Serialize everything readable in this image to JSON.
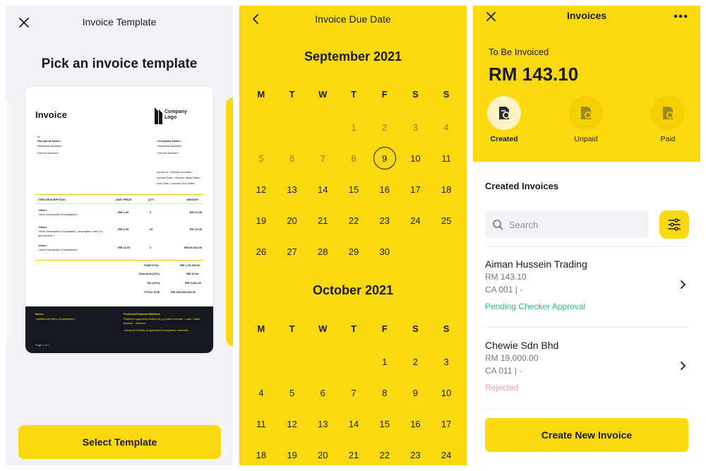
{
  "screen1": {
    "title": "Invoice Template",
    "heading": "Pick an invoice template",
    "template": {
      "invoice_title": "Invoice",
      "logo_text_1": "Company",
      "logo_text_2": "Logo",
      "to": "To :",
      "recipient_name": "<Recipient Name>",
      "business_address": "<Business Address>",
      "phone_number": "<Phone Number>",
      "company_name": "<Company Name>",
      "company_address": "<Business Address>",
      "company_phone": "<Phone Number>",
      "invoice_no": "Invoice #: <Invoice Number>",
      "invoice_date": "Invoice Date: <Invoice Issue Date>",
      "due_date": "Due Date: <Invoice Due Date>",
      "columns": [
        "ITEM DESCRIPTION",
        "UNIT PRICE",
        "QTY",
        "AMOUNT"
      ],
      "items": [
        {
          "name": "<Item>",
          "desc": "<Item Description (if available)>",
          "price": "RM 6.00",
          "qty": "2",
          "amount": "RM 24.00"
        },
        {
          "name": "<Item>",
          "desc": "<Item Description (if available), description until x to second line.>",
          "price": "RM 4.00",
          "qty": "34",
          "amount": "RM 24.00"
        },
        {
          "name": "<Item>",
          "desc": "<Item Description (if available)>",
          "price": "RM 16.00",
          "qty": "2",
          "amount": "RM 66,924.00"
        }
      ],
      "subtotal_label": "SUBTOTAL",
      "subtotal": "RM 1,23,456.00",
      "discount_label": "Discount (10%)",
      "discount": "RM 34.00",
      "tax_label": "Tax (10%)",
      "tax": "RM 3,666.20",
      "total_label": "TOTAL DUE",
      "total": "RM 999,999,345.00",
      "notes_label": "Notes:",
      "notes": "<Additional Notes (if available)>",
      "payment_label": "Preferred Payment Method:",
      "payment": "Preferred payment method (e.g.) online transfer / cash / bank transfer - others)>",
      "account": "<Account Details (if applicable to payment method)>",
      "page": "Page 1 of 1"
    },
    "button": "Select Template"
  },
  "screen2": {
    "title": "Invoice Due Date",
    "weekdays": [
      "M",
      "T",
      "W",
      "T",
      "F",
      "S",
      "S"
    ],
    "months": [
      {
        "name": "September 2021",
        "lead": 3,
        "days": 30,
        "selected": 9
      },
      {
        "name": "October 2021",
        "lead": 4,
        "days": 24,
        "selected": null
      }
    ]
  },
  "screen3": {
    "title": "Invoices",
    "to_be_invoiced_label": "To Be Invoiced",
    "amount": "RM 143.10",
    "statuses": [
      "Created",
      "Unpaid",
      "Paid"
    ],
    "section": "Created Invoices",
    "search_placeholder": "Search",
    "invoices": [
      {
        "name": "Aiman Hussein Trading",
        "amount": "RM 143.10",
        "code": "CA 001 | -",
        "status": "Pending Checker Approval",
        "status_color": "#2fc07a"
      },
      {
        "name": "Chewie Sdn Bhd",
        "amount": "RM 19,000.00",
        "code": "CA 011 | -",
        "status": "Rejected",
        "status_color": "#f3a0a8"
      }
    ],
    "create_button": "Create New Invoice"
  },
  "colors": {
    "accent": "#fbd911",
    "dark": "#16181f"
  },
  "icons": [
    "close-icon",
    "back-icon",
    "more-icon",
    "search-icon",
    "filter-icon",
    "chevron-right-icon",
    "invoice-icon"
  ]
}
